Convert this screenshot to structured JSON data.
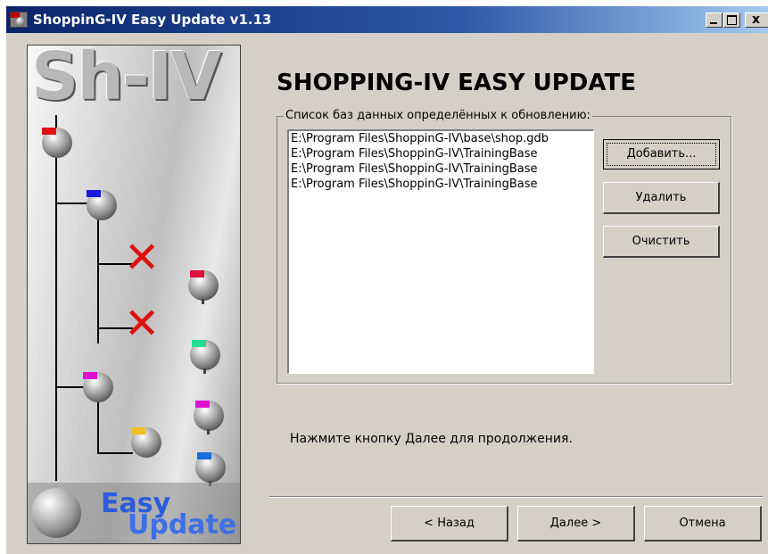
{
  "window": {
    "title": "ShoppinG-IV Easy Update v1.13",
    "close_glyph": "x"
  },
  "side_panel": {
    "logo_text": "Sh-IV",
    "easy_text": "Easy",
    "update_text": "Update"
  },
  "main": {
    "heading": "SHOPPING-IV EASY UPDATE",
    "group_label": "Список баз данных определённых к обновлению:",
    "databases": [
      "E:\\Program Files\\ShoppinG-IV\\base\\shop.gdb",
      "E:\\Program Files\\ShoppinG-IV\\TrainingBase",
      "E:\\Program Files\\ShoppinG-IV\\TrainingBase",
      "E:\\Program Files\\ShoppinG-IV\\TrainingBase"
    ],
    "add_button": "Добавить...",
    "remove_button": "Удалить",
    "clear_button": "Очистить",
    "hint": "Нажмите кнопку Далее для продолжения."
  },
  "footer": {
    "back_button": "< Назад",
    "next_button": "Далее >",
    "cancel_button": "Отмена"
  },
  "colors": {
    "title_bar": "#0a246a",
    "window_face": "#d4d0c8",
    "logo_blue": "#2b5cd9"
  }
}
